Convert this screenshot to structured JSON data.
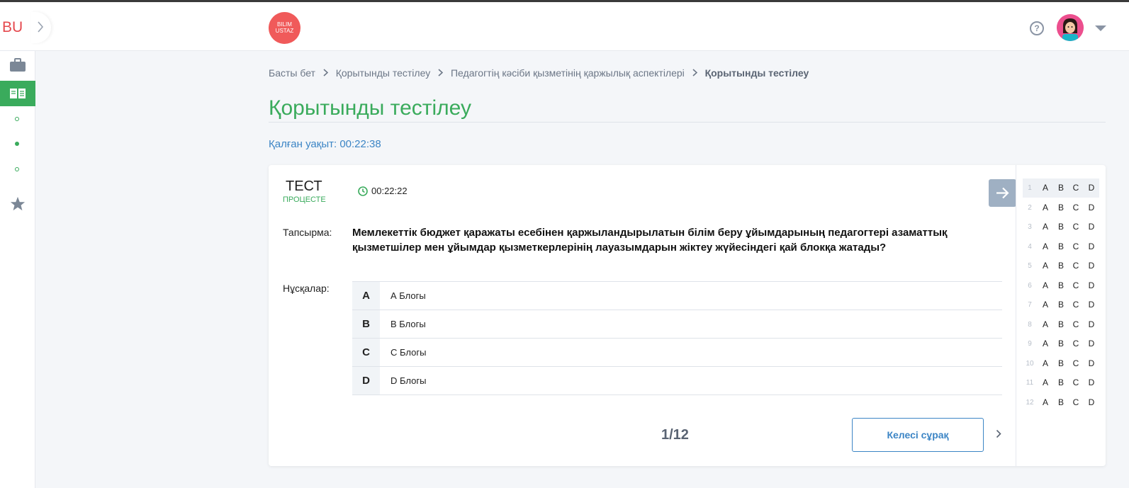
{
  "brand": {
    "short": "BU",
    "logo_line1": "BILIM",
    "logo_line2": "USTAZ"
  },
  "header": {
    "help_glyph": "?"
  },
  "breadcrumb": [
    {
      "label": "Басты бет"
    },
    {
      "label": "Қорытынды тестілеу"
    },
    {
      "label": "Педагогтің кәсіби қызметінің қаржылық аспектілері"
    },
    {
      "label": "Қорытынды тестілеу"
    }
  ],
  "page": {
    "title": "Қорытынды тестілеу",
    "remaining_label": "Қалған уақыт:",
    "remaining_time": "00:22:38"
  },
  "test": {
    "label": "ТЕСТ",
    "status": "ПРОЦЕСТЕ",
    "timer": "00:22:22",
    "task_label": "Тапсырма:",
    "question": "Мемлекеттік бюджет қаражаты есебінен қаржыландырылатын білім беру ұйымдарының педагогтері азаматтық қызметшілер мен ұйымдар қызметкерлерінің лауазымдарын жіктеу жүйесіндегі қай блокқа жатады?",
    "options_label": "Нұсқалар:",
    "options": [
      {
        "letter": "A",
        "text": "А Блогы"
      },
      {
        "letter": "B",
        "text": "В Блогы"
      },
      {
        "letter": "C",
        "text": "С Блогы"
      },
      {
        "letter": "D",
        "text": "D Блогы"
      }
    ],
    "counter": "1/12",
    "next_button": "Келесі сұрақ"
  },
  "answer_sheet": {
    "letters": [
      "A",
      "B",
      "C",
      "D"
    ],
    "rows": [
      "1",
      "2",
      "3",
      "4",
      "5",
      "6",
      "7",
      "8",
      "9",
      "10",
      "11",
      "12"
    ],
    "current": "1"
  },
  "colors": {
    "accent_green": "#3aab5c",
    "link_blue": "#3c85c5",
    "logo_red": "#f05a5a"
  },
  "icons": [
    "chevron-right-icon",
    "briefcase-icon",
    "book-icon",
    "star-icon",
    "help-icon",
    "clock-icon",
    "arrow-right-icon",
    "caret-down-icon"
  ]
}
